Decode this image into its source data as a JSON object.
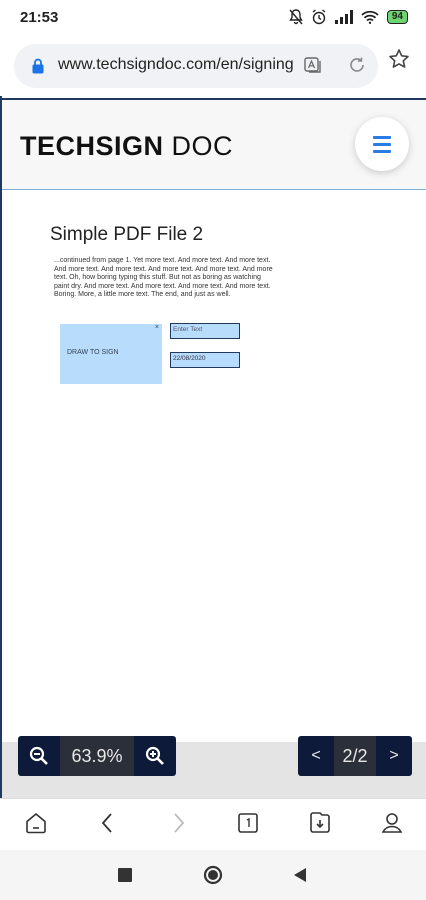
{
  "status_bar": {
    "time": "21:53",
    "battery": "94"
  },
  "browser": {
    "url": "www.techsigndoc.com/en/signing"
  },
  "site": {
    "logo_bold": "TECHSIGN",
    "logo_light": " DOC"
  },
  "document": {
    "title": "Simple PDF File 2",
    "body": "...continued from page 1. Yet more text. And more text. And more text. And more text. And more text. And more text. And more text. And more text. Oh, how boring typing this stuff. But not as boring as watching paint dry. And more text. And more text. And more text. And more text. Boring.  More, a little more text. The end, and just as well.",
    "signature_label": "DRAW TO SIGN",
    "signature_close": "×",
    "text_field_placeholder": "Enter Text",
    "date_field_value": "22/08/2020"
  },
  "viewer": {
    "zoom": "63.9%",
    "page": "2/2",
    "prev": "<",
    "next": ">"
  }
}
